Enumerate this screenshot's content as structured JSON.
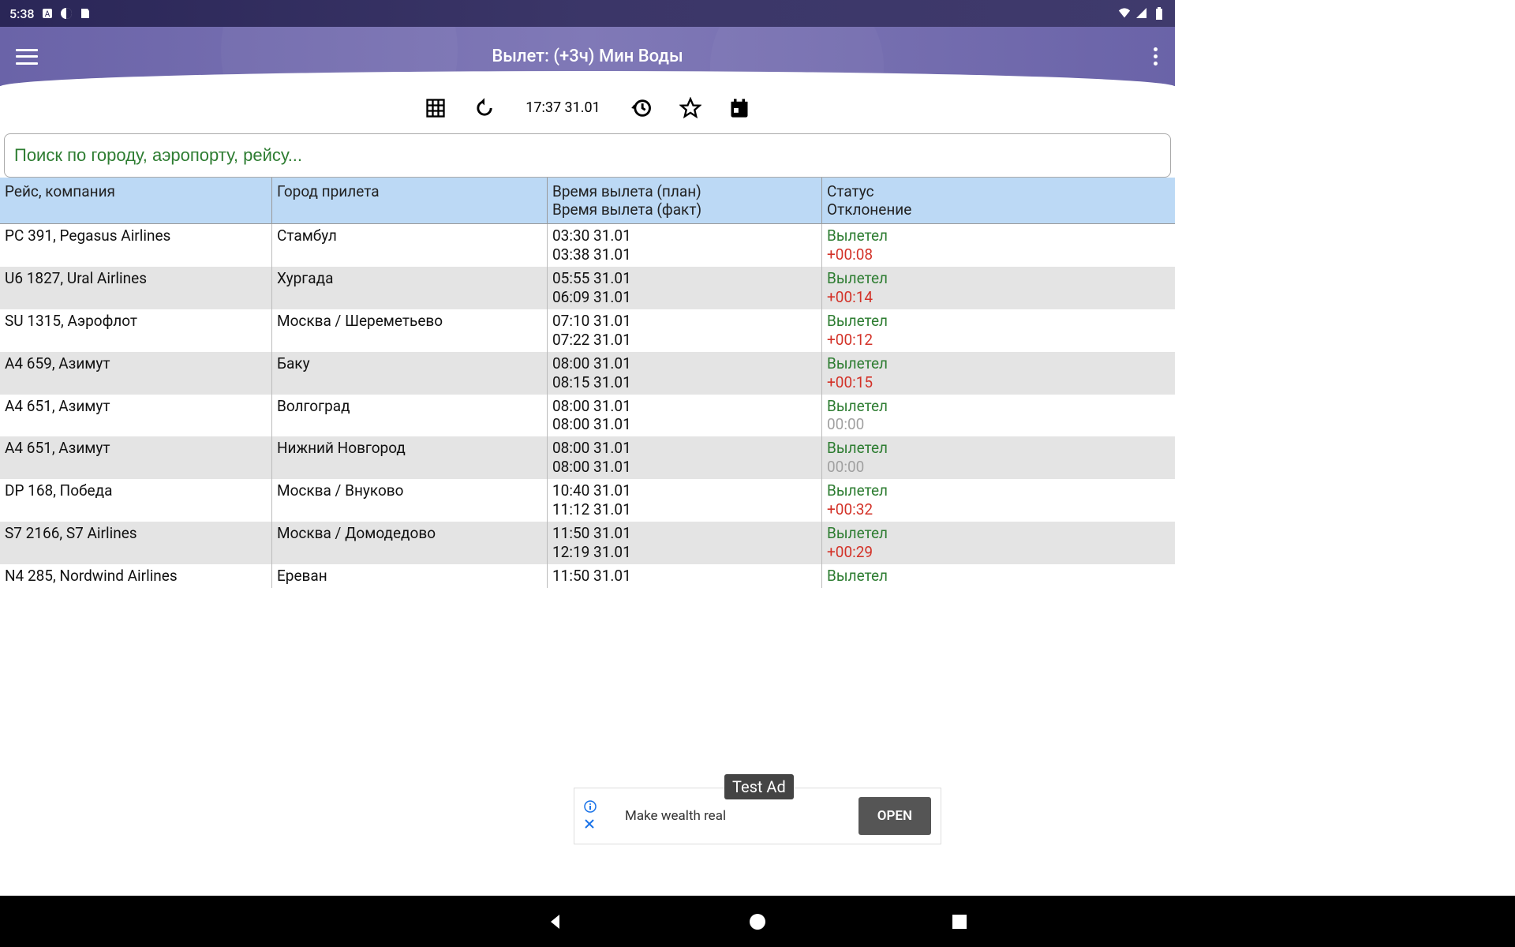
{
  "status_bar": {
    "time": "5:38"
  },
  "app": {
    "title": "Вылет: (+3ч) Мин Воды"
  },
  "toolbar": {
    "current_time": "17:37 31.01"
  },
  "search": {
    "placeholder": "Поиск по городу, аэропорту, рейсу..."
  },
  "table": {
    "headers": {
      "col1": "Рейс, компания",
      "col2": "Город прилета",
      "col3_line1": "Время вылета (план)",
      "col3_line2": "Время вылета (факт)",
      "col4_line1": "Статус",
      "col4_line2": "Отклонение"
    },
    "rows": [
      {
        "flight": "PC 391, Pegasus Airlines",
        "city": "Стамбул",
        "t1": "03:30 31.01",
        "t2": "03:38 31.01",
        "status": "Вылетел",
        "dev": "+00:08",
        "devClass": "dev-red"
      },
      {
        "flight": "U6 1827, Ural Airlines",
        "city": "Хургада",
        "t1": "05:55 31.01",
        "t2": "06:09 31.01",
        "status": "Вылетел",
        "dev": "+00:14",
        "devClass": "dev-red"
      },
      {
        "flight": "SU 1315, Аэрофлот",
        "city": "Москва / Шереметьево",
        "t1": "07:10 31.01",
        "t2": "07:22 31.01",
        "status": "Вылетел",
        "dev": "+00:12",
        "devClass": "dev-red"
      },
      {
        "flight": "A4 659, Азимут",
        "city": "Баку",
        "t1": "08:00 31.01",
        "t2": "08:15 31.01",
        "status": "Вылетел",
        "dev": "+00:15",
        "devClass": "dev-red"
      },
      {
        "flight": "A4 651, Азимут",
        "city": "Волгоград",
        "t1": "08:00 31.01",
        "t2": "08:00 31.01",
        "status": "Вылетел",
        "dev": "00:00",
        "devClass": "dev-gray"
      },
      {
        "flight": "A4 651, Азимут",
        "city": "Нижний Новгород",
        "t1": "08:00 31.01",
        "t2": "08:00 31.01",
        "status": "Вылетел",
        "dev": "00:00",
        "devClass": "dev-gray"
      },
      {
        "flight": "DP 168, Победа",
        "city": "Москва / Внуково",
        "t1": "10:40 31.01",
        "t2": "11:12 31.01",
        "status": "Вылетел",
        "dev": "+00:32",
        "devClass": "dev-red"
      },
      {
        "flight": "S7 2166, S7 Airlines",
        "city": "Москва / Домодедово",
        "t1": "11:50 31.01",
        "t2": "12:19 31.01",
        "status": "Вылетел",
        "dev": "+00:29",
        "devClass": "dev-red"
      },
      {
        "flight": "N4 285, Nordwind Airlines",
        "city": "Ереван",
        "t1": "11:50 31.01",
        "t2": "",
        "status": "Вылетел",
        "dev": "",
        "devClass": ""
      }
    ]
  },
  "ad": {
    "label": "Test Ad",
    "text": "Make wealth real",
    "button": "OPEN"
  }
}
